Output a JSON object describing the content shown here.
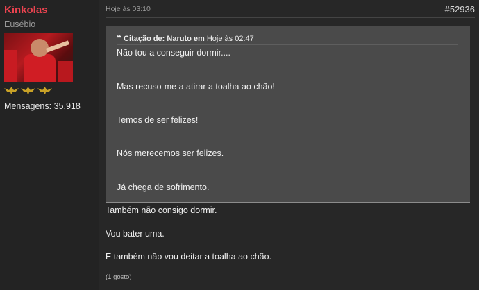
{
  "author": {
    "username": "Kinkolas",
    "rank": "Eusébio",
    "message_count": "Mensagens: 35.918",
    "rank_icon": "eagle-icon",
    "rank_icon_count": 3
  },
  "post": {
    "date": "Hoje às 03:10",
    "id": "#52936",
    "quote": {
      "header_prefix": "Citação de: Naruto em",
      "header_time": "Hoje às 02:47",
      "lines": [
        "Não tou a conseguir dormir....",
        "Mas recuso-me a atirar a toalha ao chão!",
        "Temos de ser felizes!",
        "Nós merecemos ser felizes.",
        "Já chega de sofrimento."
      ]
    },
    "body": [
      "Também não consigo dormir.",
      "Vou bater uma.",
      "E também não vou deitar a toalha ao chão."
    ],
    "likes": "(1 gosto)"
  },
  "colors": {
    "username": "#e8434f",
    "background": "#272727",
    "quote_background": "#4a4a4a",
    "eagle": "#c9a227"
  }
}
